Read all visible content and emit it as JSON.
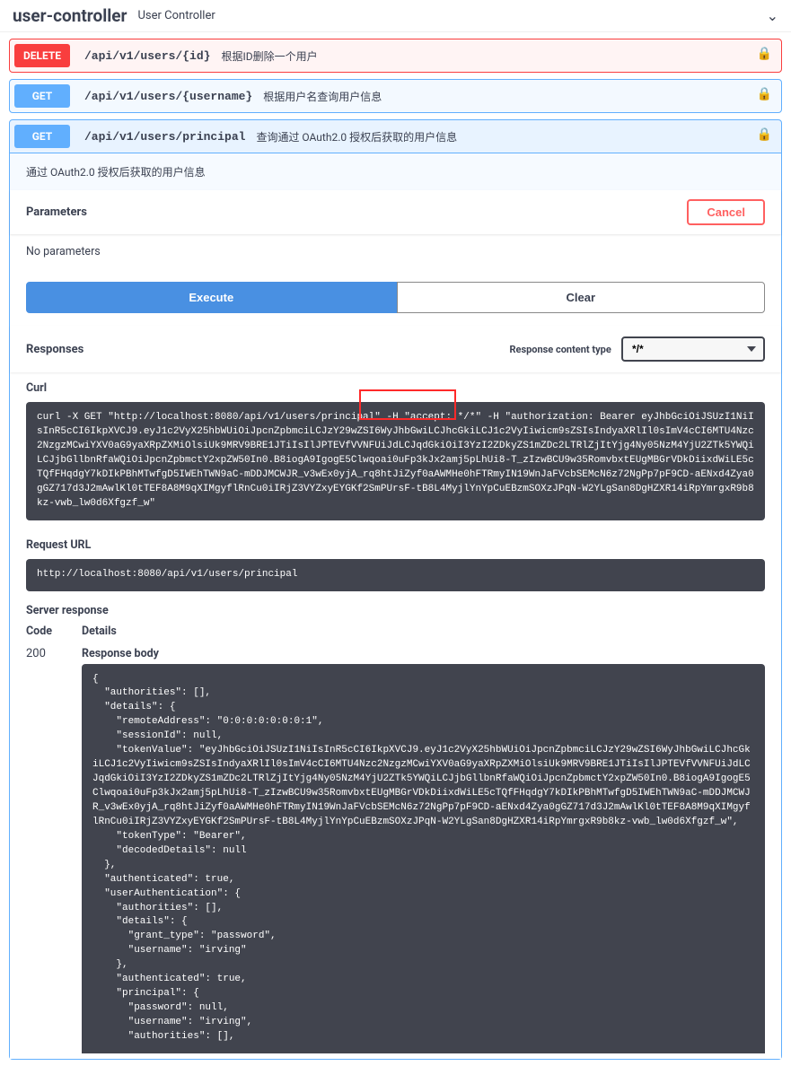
{
  "tag": {
    "name": "user-controller",
    "desc": "User Controller"
  },
  "ops": [
    {
      "method": "DELETE",
      "path": "/api/v1/users/{id}",
      "desc": "根据ID删除一个用户"
    },
    {
      "method": "GET",
      "path": "/api/v1/users/{username}",
      "desc": "根据用户名查询用户信息"
    },
    {
      "method": "GET",
      "path": "/api/v1/users/principal",
      "desc": "查询通过 OAuth2.0 授权后获取的用户信息"
    }
  ],
  "open_note": "通过 OAuth2.0 授权后获取的用户信息",
  "labels": {
    "parameters": "Parameters",
    "cancel": "Cancel",
    "no_params": "No parameters",
    "execute": "Execute",
    "clear": "Clear",
    "responses": "Responses",
    "content_type": "Response content type",
    "curl": "Curl",
    "request_url": "Request URL",
    "server_response": "Server response",
    "code": "Code",
    "details": "Details",
    "response_body": "Response body"
  },
  "content_type_value": "*/*",
  "curl_text": "curl -X GET \"http://localhost:8080/api/v1/users/principal\" -H \"accept: */*\" -H \"authorization: Bearer eyJhbGciOiJSUzI1NiIsInR5cCI6IkpXVCJ9.eyJ1c2VyX25hbWUiOiJpcnZpbmciLCJzY29wZSI6WyJhbGwiLCJhcGkiLCJ1c2VyIiwicm9sZSIsIndyaXRlIl0sImV4cCI6MTU4Nzc2NzgzMCwiYXV0aG9yaXRpZXMiOlsiUk9MRV9BRE1JTiIsIlJPTEVfVVNFUiJdLCJqdGkiOiI3YzI2ZDkyZS1mZDc2LTRlZjItYjg4Ny05NzM4YjU2ZTk5YWQiLCJjbGllbnRfaWQiOiJpcnZpbmctY2xpZW50In0.B8iogA9IgogE5Clwqoai0uFp3kJx2amj5pLhUi8-T_zIzwBCU9w35RomvbxtEUgMBGrVDkDiixdWiLE5cTQfFHqdgY7kDIkPBhMTwfgD5IWEhTWN9aC-mDDJMCWJR_v3wEx0yjA_rq8htJiZyf0aAWMHe0hFTRmyIN19WnJaFVcbSEMcN6z72NgPp7pF9CD-aENxd4Zya0gGZ717d3J2mAwlKl0tTEF8A8M9qXIMgyflRnCu0iIRjZ3VYZxyEYGKf2SmPUrsF-tB8L4MyjlYnYpCuEBzmSOXzJPqN-W2YLgSan8DgHZXR14iRpYmrgxR9b8kz-vwb_lw0d6Xfgzf_w\"",
  "request_url_text": "http://localhost:8080/api/v1/users/principal",
  "response_code": "200",
  "response_body_text": "{\n  \"authorities\": [],\n  \"details\": {\n    \"remoteAddress\": \"0:0:0:0:0:0:0:1\",\n    \"sessionId\": null,\n    \"tokenValue\": \"eyJhbGciOiJSUzI1NiIsInR5cCI6IkpXVCJ9.eyJ1c2VyX25hbWUiOiJpcnZpbmciLCJzY29wZSI6WyJhbGwiLCJhcGkiLCJ1c2VyIiwicm9sZSIsIndyaXRlIl0sImV4cCI6MTU4Nzc2NzgzMCwiYXV0aG9yaXRpZXMiOlsiUk9MRV9BRE1JTiIsIlJPTEVfVVNFUiJdLCJqdGkiOiI3YzI2ZDkyZS1mZDc2LTRlZjItYjg4Ny05NzM4YjU2ZTk5YWQiLCJjbGllbnRfaWQiOiJpcnZpbmctY2xpZW50In0.B8iogA9IgogE5Clwqoai0uFp3kJx2amj5pLhUi8-T_zIzwBCU9w35RomvbxtEUgMBGrVDkDiixdWiLE5cTQfFHqdgY7kDIkPBhMTwfgD5IWEhTWN9aC-mDDJMCWJR_v3wEx0yjA_rq8htJiZyf0aAWMHe0hFTRmyIN19WnJaFVcbSEMcN6z72NgPp7pF9CD-aENxd4Zya0gGZ717d3J2mAwlKl0tTEF8A8M9qXIMgyflRnCu0iIRjZ3VYZxyEYGKf2SmPUrsF-tB8L4MyjlYnYpCuEBzmSOXzJPqN-W2YLgSan8DgHZXR14iRpYmrgxR9b8kz-vwb_lw0d6Xfgzf_w\",\n    \"tokenType\": \"Bearer\",\n    \"decodedDetails\": null\n  },\n  \"authenticated\": true,\n  \"userAuthentication\": {\n    \"authorities\": [],\n    \"details\": {\n      \"grant_type\": \"password\",\n      \"username\": \"irving\"\n    },\n    \"authenticated\": true,\n    \"principal\": {\n      \"password\": null,\n      \"username\": \"irving\",\n      \"authorities\": [],"
}
